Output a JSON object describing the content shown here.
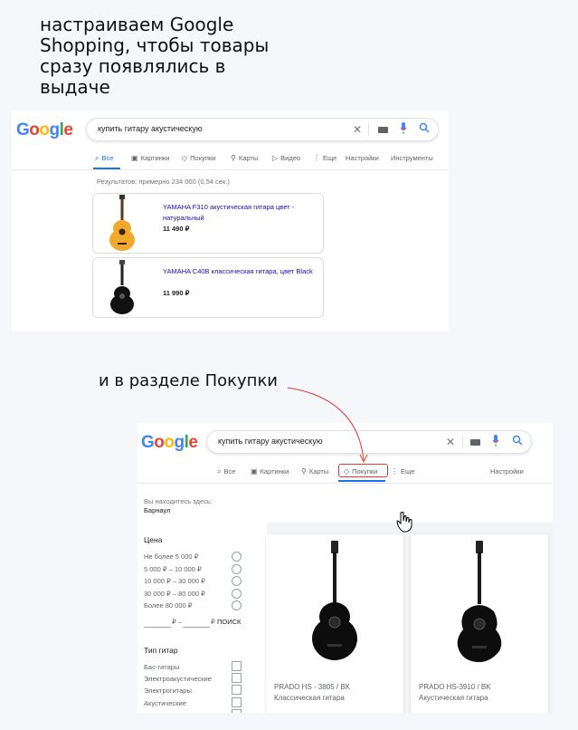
{
  "caption_top": "настраиваем Google Shopping, чтобы товары сразу появлялись в выдаче",
  "caption_mid": "и в разделе Покупки",
  "logo": [
    "G",
    "o",
    "o",
    "g",
    "l",
    "e"
  ],
  "colors": {
    "accent": "#1a73e8",
    "link": "#1a0dab",
    "annotation": "#e53935"
  },
  "panel1": {
    "query": "купить гитару акустическую",
    "tabs": [
      {
        "label": "Все",
        "icon": "search-icon",
        "active": true
      },
      {
        "label": "Картинки",
        "icon": "image-icon"
      },
      {
        "label": "Покупки",
        "icon": "tag-icon"
      },
      {
        "label": "Карты",
        "icon": "map-pin-icon"
      },
      {
        "label": "Видео",
        "icon": "play-icon"
      },
      {
        "label": "Еще",
        "icon": "more-icon"
      },
      {
        "label": "Настройки"
      },
      {
        "label": "Инструменты"
      }
    ],
    "stats": "Результатов: примерно 234 000 (0,54 сек.)",
    "products": [
      {
        "title": "YAMAHA F310 акустическая гитара цвет - натуральный",
        "price": "11 490 ₽",
        "color": "#f0a92c"
      },
      {
        "title": "YAMAHA C40B классическая гитара, цвет Black",
        "price": "11 990 ₽",
        "color": "#111111"
      }
    ]
  },
  "panel2": {
    "query": "купить гитару акустическую",
    "tabs": [
      {
        "label": "Все",
        "icon": "search-icon"
      },
      {
        "label": "Картинки",
        "icon": "image-icon"
      },
      {
        "label": "Карты",
        "icon": "map-pin-icon"
      },
      {
        "label": "Покупки",
        "icon": "tag-icon",
        "active": true
      },
      {
        "label": "Еще",
        "icon": "more-icon"
      }
    ],
    "settings": "Настройки",
    "location_label": "Вы находитесь здесь:",
    "location_value": "Барнаул",
    "price_heading": "Цена",
    "price_options": [
      "Не более 5 000 ₽",
      "5 000 ₽ – 10 000 ₽",
      "10 000 ₽ – 30 000 ₽",
      "30 000 ₽ – 80 000 ₽",
      "Более 80 000 ₽"
    ],
    "range_from_unit": "₽ –",
    "range_to_unit": "₽",
    "range_search": "ПОИСК",
    "type_heading": "Тип гитар",
    "type_options": [
      "Бас-гитары",
      "Электроакустические",
      "Электрогитары",
      "Акустические"
    ],
    "products": [
      {
        "name": "PRADO HS - 3805 / BK",
        "type": "Классическая гитара"
      },
      {
        "name": "PRADO HS-3910 / BK",
        "type": "Акустическая гитара"
      }
    ]
  }
}
